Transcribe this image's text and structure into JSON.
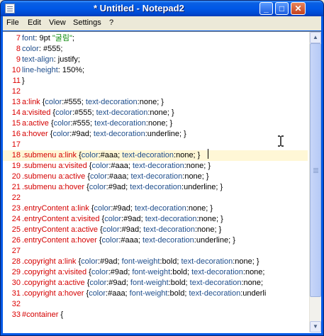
{
  "window": {
    "title": "* Untitled - Notepad2"
  },
  "titlebar": {
    "minimize_glyph": "_",
    "maximize_glyph": "□",
    "close_glyph": "✕"
  },
  "menu": [
    "File",
    "Edit",
    "View",
    "Settings",
    "?"
  ],
  "editor": {
    "current_line": "18",
    "lines": [
      {
        "n": "7",
        "tokens": [
          {
            "t": "font",
            "c": "k"
          },
          {
            "t": ": 9pt ",
            "c": "p"
          },
          {
            "t": "\"굴림\"",
            "c": "s"
          },
          {
            "t": ";",
            "c": "p"
          }
        ]
      },
      {
        "n": "8",
        "tokens": [
          {
            "t": "color",
            "c": "k"
          },
          {
            "t": ": #555;",
            "c": "p"
          }
        ]
      },
      {
        "n": "9",
        "tokens": [
          {
            "t": "text-align",
            "c": "k"
          },
          {
            "t": ": justify;",
            "c": "p"
          }
        ]
      },
      {
        "n": "10",
        "tokens": [
          {
            "t": "line-height",
            "c": "k"
          },
          {
            "t": ": 150%;",
            "c": "p"
          }
        ]
      },
      {
        "n": "11",
        "tokens": [
          {
            "t": "}",
            "c": "p"
          }
        ]
      },
      {
        "n": "12",
        "tokens": []
      },
      {
        "n": "13",
        "tokens": [
          {
            "t": "a",
            "c": "sel"
          },
          {
            "t": ":link",
            "c": "sel"
          },
          {
            "t": " {",
            "c": "p"
          },
          {
            "t": "color",
            "c": "k"
          },
          {
            "t": ":#555; ",
            "c": "p"
          },
          {
            "t": "text-decoration",
            "c": "k"
          },
          {
            "t": ":none; }",
            "c": "p"
          }
        ]
      },
      {
        "n": "14",
        "tokens": [
          {
            "t": "a",
            "c": "sel"
          },
          {
            "t": ":visited",
            "c": "sel"
          },
          {
            "t": " {",
            "c": "p"
          },
          {
            "t": "color",
            "c": "k"
          },
          {
            "t": ":#555; ",
            "c": "p"
          },
          {
            "t": "text-decoration",
            "c": "k"
          },
          {
            "t": ":none; }",
            "c": "p"
          }
        ]
      },
      {
        "n": "15",
        "tokens": [
          {
            "t": "a",
            "c": "sel"
          },
          {
            "t": ":active",
            "c": "sel"
          },
          {
            "t": " {",
            "c": "p"
          },
          {
            "t": "color",
            "c": "k"
          },
          {
            "t": ":#555; ",
            "c": "p"
          },
          {
            "t": "text-decoration",
            "c": "k"
          },
          {
            "t": ":none; }",
            "c": "p"
          }
        ]
      },
      {
        "n": "16",
        "tokens": [
          {
            "t": "a",
            "c": "sel"
          },
          {
            "t": ":hover",
            "c": "sel"
          },
          {
            "t": " {",
            "c": "p"
          },
          {
            "t": "color",
            "c": "k"
          },
          {
            "t": ":#9ad; ",
            "c": "p"
          },
          {
            "t": "text-decoration",
            "c": "k"
          },
          {
            "t": ":underline; }",
            "c": "p"
          }
        ]
      },
      {
        "n": "17",
        "tokens": []
      },
      {
        "n": "18",
        "tokens": [
          {
            "t": ".submenu a",
            "c": "sel"
          },
          {
            "t": ":link",
            "c": "sel"
          },
          {
            "t": " {",
            "c": "p"
          },
          {
            "t": "color",
            "c": "k"
          },
          {
            "t": ":#aaa; ",
            "c": "p"
          },
          {
            "t": "text-decoration",
            "c": "k"
          },
          {
            "t": ":none; }",
            "c": "p"
          }
        ]
      },
      {
        "n": "19",
        "tokens": [
          {
            "t": ".submenu a",
            "c": "sel"
          },
          {
            "t": ":visited",
            "c": "sel"
          },
          {
            "t": " {",
            "c": "p"
          },
          {
            "t": "color",
            "c": "k"
          },
          {
            "t": ":#aaa; ",
            "c": "p"
          },
          {
            "t": "text-decoration",
            "c": "k"
          },
          {
            "t": ":none; }",
            "c": "p"
          }
        ]
      },
      {
        "n": "20",
        "tokens": [
          {
            "t": ".submenu a",
            "c": "sel"
          },
          {
            "t": ":active",
            "c": "sel"
          },
          {
            "t": " {",
            "c": "p"
          },
          {
            "t": "color",
            "c": "k"
          },
          {
            "t": ":#aaa; ",
            "c": "p"
          },
          {
            "t": "text-decoration",
            "c": "k"
          },
          {
            "t": ":none; }",
            "c": "p"
          }
        ]
      },
      {
        "n": "21",
        "tokens": [
          {
            "t": ".submenu a",
            "c": "sel"
          },
          {
            "t": ":hover",
            "c": "sel"
          },
          {
            "t": " {",
            "c": "p"
          },
          {
            "t": "color",
            "c": "k"
          },
          {
            "t": ":#9ad; ",
            "c": "p"
          },
          {
            "t": "text-decoration",
            "c": "k"
          },
          {
            "t": ":underline; }",
            "c": "p"
          }
        ]
      },
      {
        "n": "22",
        "tokens": []
      },
      {
        "n": "23",
        "tokens": [
          {
            "t": ".entryContent a",
            "c": "sel"
          },
          {
            "t": ":link",
            "c": "sel"
          },
          {
            "t": " {",
            "c": "p"
          },
          {
            "t": "color",
            "c": "k"
          },
          {
            "t": ":#9ad; ",
            "c": "p"
          },
          {
            "t": "text-decoration",
            "c": "k"
          },
          {
            "t": ":none; }",
            "c": "p"
          }
        ]
      },
      {
        "n": "24",
        "tokens": [
          {
            "t": ".entryContent a",
            "c": "sel"
          },
          {
            "t": ":visited",
            "c": "sel"
          },
          {
            "t": " {",
            "c": "p"
          },
          {
            "t": "color",
            "c": "k"
          },
          {
            "t": ":#9ad; ",
            "c": "p"
          },
          {
            "t": "text-decoration",
            "c": "k"
          },
          {
            "t": ":none; }",
            "c": "p"
          }
        ]
      },
      {
        "n": "25",
        "tokens": [
          {
            "t": ".entryContent a",
            "c": "sel"
          },
          {
            "t": ":active",
            "c": "sel"
          },
          {
            "t": " {",
            "c": "p"
          },
          {
            "t": "color",
            "c": "k"
          },
          {
            "t": ":#9ad; ",
            "c": "p"
          },
          {
            "t": "text-decoration",
            "c": "k"
          },
          {
            "t": ":none; }",
            "c": "p"
          }
        ]
      },
      {
        "n": "26",
        "tokens": [
          {
            "t": ".entryContent a",
            "c": "sel"
          },
          {
            "t": ":hover",
            "c": "sel"
          },
          {
            "t": " {",
            "c": "p"
          },
          {
            "t": "color",
            "c": "k"
          },
          {
            "t": ":#aaa; ",
            "c": "p"
          },
          {
            "t": "text-decoration",
            "c": "k"
          },
          {
            "t": ":underline; }",
            "c": "p"
          }
        ]
      },
      {
        "n": "27",
        "tokens": []
      },
      {
        "n": "28",
        "tokens": [
          {
            "t": ".copyright a",
            "c": "sel"
          },
          {
            "t": ":link",
            "c": "sel"
          },
          {
            "t": " {",
            "c": "p"
          },
          {
            "t": "color",
            "c": "k"
          },
          {
            "t": ":#9ad; ",
            "c": "p"
          },
          {
            "t": "font-weight",
            "c": "k"
          },
          {
            "t": ":bold; ",
            "c": "p"
          },
          {
            "t": "text-decoration",
            "c": "k"
          },
          {
            "t": ":none; }",
            "c": "p"
          }
        ]
      },
      {
        "n": "29",
        "tokens": [
          {
            "t": ".copyright a",
            "c": "sel"
          },
          {
            "t": ":visited",
            "c": "sel"
          },
          {
            "t": " {",
            "c": "p"
          },
          {
            "t": "color",
            "c": "k"
          },
          {
            "t": ":#9ad; ",
            "c": "p"
          },
          {
            "t": "font-weight",
            "c": "k"
          },
          {
            "t": ":bold; ",
            "c": "p"
          },
          {
            "t": "text-decoration",
            "c": "k"
          },
          {
            "t": ":none; ",
            "c": "p"
          }
        ]
      },
      {
        "n": "30",
        "tokens": [
          {
            "t": ".copyright a",
            "c": "sel"
          },
          {
            "t": ":active",
            "c": "sel"
          },
          {
            "t": " {",
            "c": "p"
          },
          {
            "t": "color",
            "c": "k"
          },
          {
            "t": ":#9ad; ",
            "c": "p"
          },
          {
            "t": "font-weight",
            "c": "k"
          },
          {
            "t": ":bold; ",
            "c": "p"
          },
          {
            "t": "text-decoration",
            "c": "k"
          },
          {
            "t": ":none; ",
            "c": "p"
          }
        ]
      },
      {
        "n": "31",
        "tokens": [
          {
            "t": ".copyright a",
            "c": "sel"
          },
          {
            "t": ":hover",
            "c": "sel"
          },
          {
            "t": " {",
            "c": "p"
          },
          {
            "t": "color",
            "c": "k"
          },
          {
            "t": ":#aaa; ",
            "c": "p"
          },
          {
            "t": "font-weight",
            "c": "k"
          },
          {
            "t": ":bold; ",
            "c": "p"
          },
          {
            "t": "text-decoration",
            "c": "k"
          },
          {
            "t": ":underli",
            "c": "p"
          }
        ]
      },
      {
        "n": "32",
        "tokens": []
      },
      {
        "n": "33",
        "tokens": [
          {
            "t": "#container",
            "c": "sel"
          },
          {
            "t": " {",
            "c": "p"
          }
        ]
      }
    ]
  },
  "colors": {
    "keyword": "#1f4e8c",
    "string": "#0a8a0a",
    "selector": "#d40000",
    "line_number": "#dd0000",
    "current_line_bg": "#fff7d6",
    "titlebar": "#0058e6"
  }
}
